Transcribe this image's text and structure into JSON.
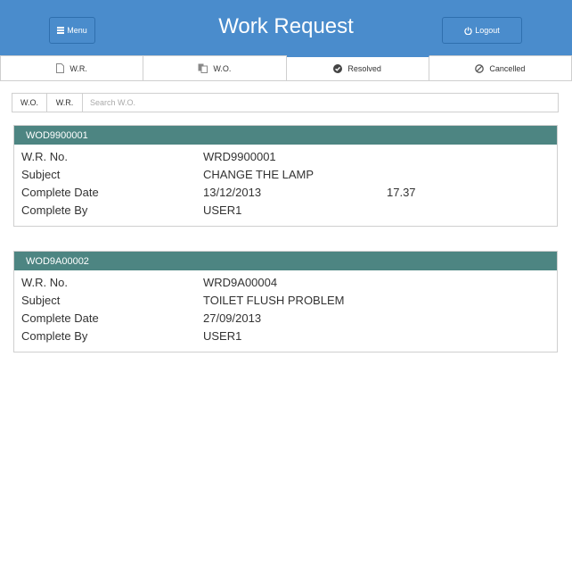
{
  "header": {
    "title": "Work Request",
    "menu_label": "Menu",
    "logout_label": "Logout"
  },
  "tabs": [
    {
      "label": "W.R.",
      "icon": "document-icon",
      "active": false
    },
    {
      "label": "W.O.",
      "icon": "documents-icon",
      "active": false
    },
    {
      "label": "Resolved",
      "icon": "check-circle-icon",
      "active": true
    },
    {
      "label": "Cancelled",
      "icon": "ban-icon",
      "active": false
    }
  ],
  "search": {
    "filter_wo": "W.O.",
    "filter_wr": "W.R.",
    "placeholder": "Search W.O."
  },
  "field_labels": {
    "wr_no": "W.R. No.",
    "subject": "Subject",
    "complete_date": "Complete Date",
    "complete_by": "Complete By"
  },
  "orders": [
    {
      "wo_no": "WOD9900001",
      "wr_no": "WRD9900001",
      "subject": "CHANGE THE LAMP",
      "complete_date": "13/12/2013",
      "complete_time": "17.37",
      "complete_by": "USER1"
    },
    {
      "wo_no": "WOD9A00002",
      "wr_no": "WRD9A00004",
      "subject": "TOILET FLUSH PROBLEM",
      "complete_date": "27/09/2013",
      "complete_time": "",
      "complete_by": "USER1"
    }
  ],
  "colors": {
    "header_bg": "#4a8ccc",
    "card_header_bg": "#4d8582",
    "active_tab_border": "#4a8ccc"
  }
}
